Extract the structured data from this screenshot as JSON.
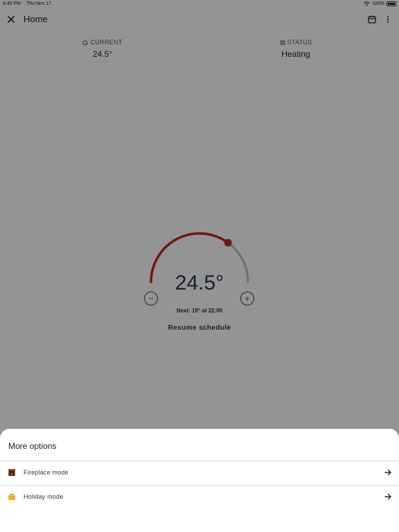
{
  "status_bar": {
    "time": "6:40 PM",
    "date": "Thu Nov 17",
    "battery": "100%"
  },
  "app_bar": {
    "title": "Home"
  },
  "info": {
    "current_label": "CURRENT",
    "current_value": "24.5°",
    "status_label": "STATUS",
    "status_value": "Heating"
  },
  "dial": {
    "target_temp": "24.5°",
    "next": "Next: 19° at 22:00",
    "minus": "−",
    "plus": "+",
    "level": 0.7,
    "accent_color": "#c0281c"
  },
  "resume_label": "Resume schedule",
  "sheet": {
    "title": "More options",
    "options": [
      {
        "label": "Fireplace mode",
        "icon": "fireplace-icon"
      },
      {
        "label": "Holiday mode",
        "icon": "suitcase-icon"
      }
    ]
  }
}
